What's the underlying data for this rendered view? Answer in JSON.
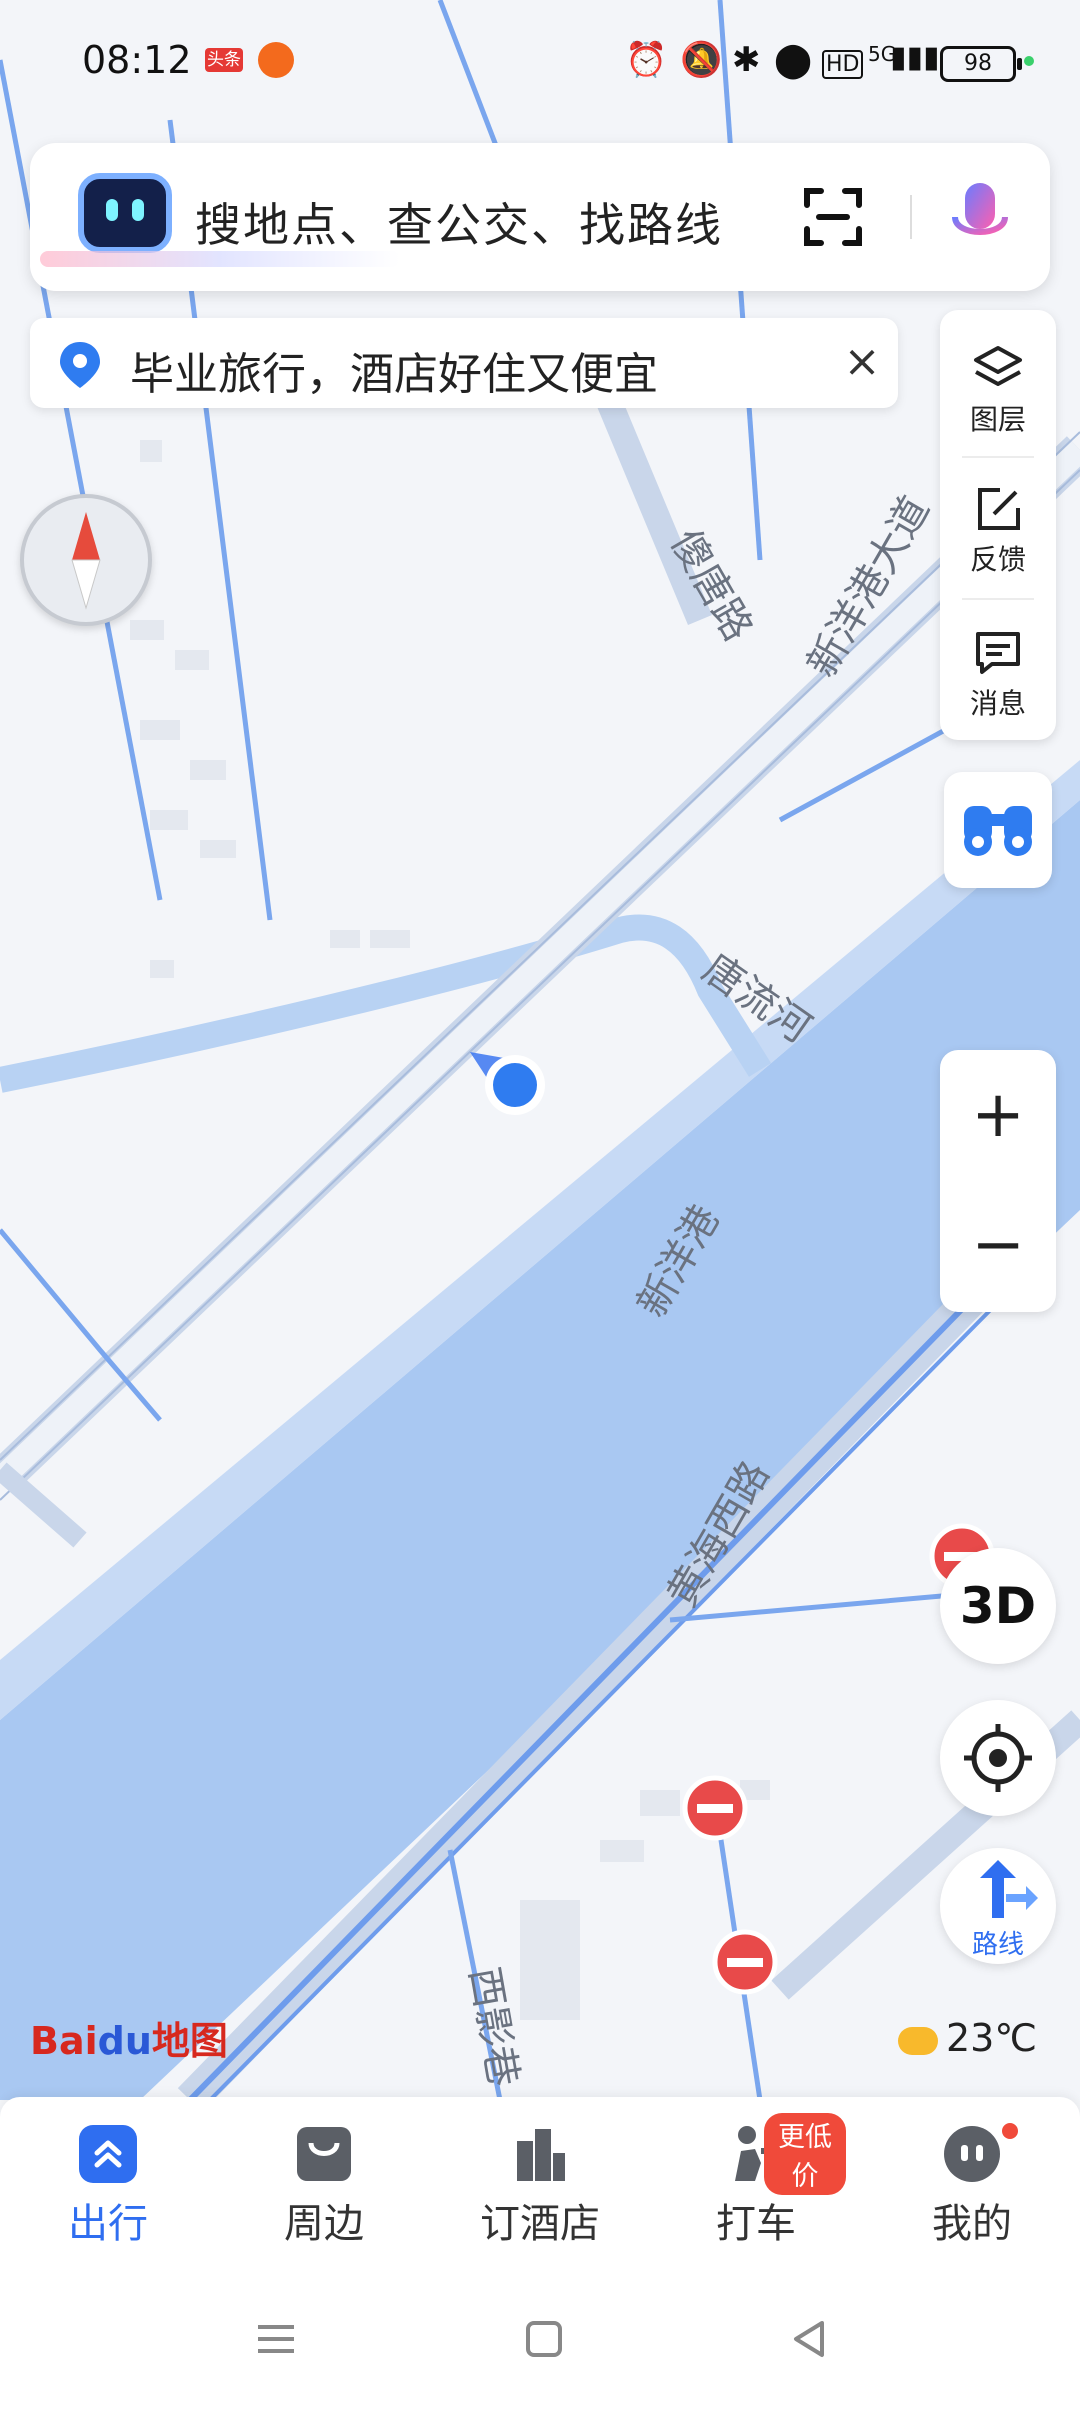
{
  "status_bar": {
    "time": "08:12",
    "news_badge": "头条",
    "network": "5G",
    "hd": "HD",
    "battery": "98"
  },
  "search": {
    "placeholder": "搜地点、查公交、找路线",
    "scan_icon": "scan-icon",
    "voice_icon": "microphone-icon"
  },
  "notice": {
    "text": "毕业旅行，酒店好住又便宜",
    "close": "×"
  },
  "map_controls": {
    "layers_label": "图层",
    "feedback_label": "反馈",
    "message_label": "消息",
    "btn_3d": "3D",
    "zoom_in": "+",
    "zoom_out": "−",
    "route_label": "路线"
  },
  "map_labels": {
    "road_1": "傻唐路",
    "road_2": "新洋港大道",
    "river_1": "唐流河",
    "river_2": "新洋港",
    "road_3": "黄海西路",
    "road_4": "西影巷"
  },
  "logo": {
    "text_a": "Bai",
    "text_b": "du",
    "text_c": "地图"
  },
  "weather": {
    "temperature": "23℃"
  },
  "tabs": [
    {
      "label": "出行",
      "active": true
    },
    {
      "label": "周边",
      "active": false
    },
    {
      "label": "订酒店",
      "active": false
    },
    {
      "label": "打车",
      "active": false,
      "badge": "更低价"
    },
    {
      "label": "我的",
      "active": false
    }
  ],
  "colors": {
    "accent": "#2f6ef0",
    "river": "#a7c7f2",
    "road": "#7aa6ee"
  }
}
